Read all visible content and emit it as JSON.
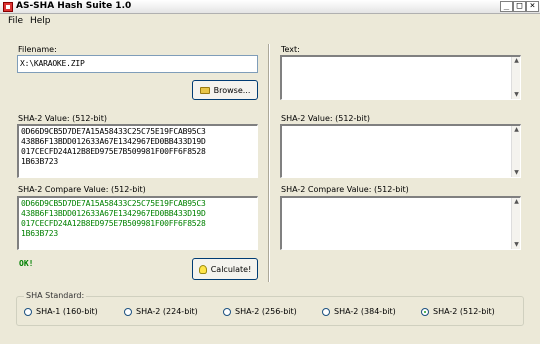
{
  "window": {
    "title": "AS-SHA Hash Suite 1.0",
    "min": "_",
    "max": "□",
    "close": "×"
  },
  "menu": {
    "file": "File",
    "help": "Help"
  },
  "left": {
    "filename_label": "Filename:",
    "filename_value": "X:\\KARAOKE.ZIP",
    "browse_label": "Browse...",
    "hash_label": "SHA-2 Value: (512-bit)",
    "hash_lines": [
      "0D66D9CB5D7DE7A15A58433C25C75E19FCAB95C3",
      "438B6F13BDD012633A67E1342967ED0BB433D19D",
      "017CECFD24A12B8ED975E7B509981F00FF6F8528",
      "1B63B723"
    ],
    "compare_label": "SHA-2 Compare Value: (512-bit)",
    "compare_lines": [
      "0D66D9CB5D7DE7A15A58433C25C75E19FCAB95C3",
      "438B6F13BDD012633A67E1342967ED0BB433D19D",
      "017CECFD24A12B8ED975E7B509981F00FF6F8528",
      "1B63B723"
    ],
    "status": "OK!",
    "calculate_label": "Calculate!"
  },
  "right": {
    "text_label": "Text:",
    "hash_label": "SHA-2 Value: (512-bit)",
    "compare_label": "SHA-2 Compare Value: (512-bit)"
  },
  "sha_standard": {
    "label": "SHA Standard:",
    "options": [
      "SHA-1 (160-bit)",
      "SHA-2 (224-bit)",
      "SHA-2 (256-bit)",
      "SHA-2 (384-bit)",
      "SHA-2 (512-bit)"
    ],
    "selected": "SHA-2 (512-bit)"
  },
  "colors": {
    "match": "#008000",
    "selection": "#316ac5"
  }
}
